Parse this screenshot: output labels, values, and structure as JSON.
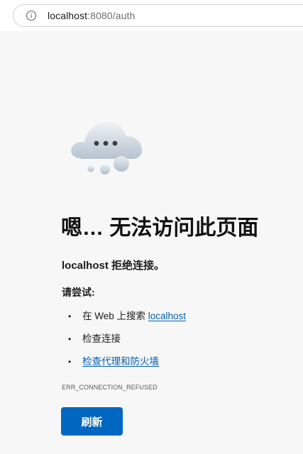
{
  "browser": {
    "url_host": "localhost",
    "url_rest": ":8080/auth",
    "info_icon": "info-circle-icon"
  },
  "illustration": {
    "icon": "cloud-with-dots-icon"
  },
  "error_page": {
    "title": "嗯… 无法访问此页面",
    "subtitle": "localhost 拒绝连接。",
    "try_heading": "请尝试:",
    "suggestions": {
      "search_prefix": "在 Web 上搜索 ",
      "search_link": "localhost",
      "check_connection": "检查连接",
      "check_proxy_link": "检查代理和防火墙"
    },
    "bullet": "•",
    "error_code": "ERR_CONNECTION_REFUSED",
    "refresh_label": "刷新"
  },
  "colors": {
    "accent": "#0067c0",
    "link": "#005fb8",
    "background": "#f7f7f7"
  }
}
